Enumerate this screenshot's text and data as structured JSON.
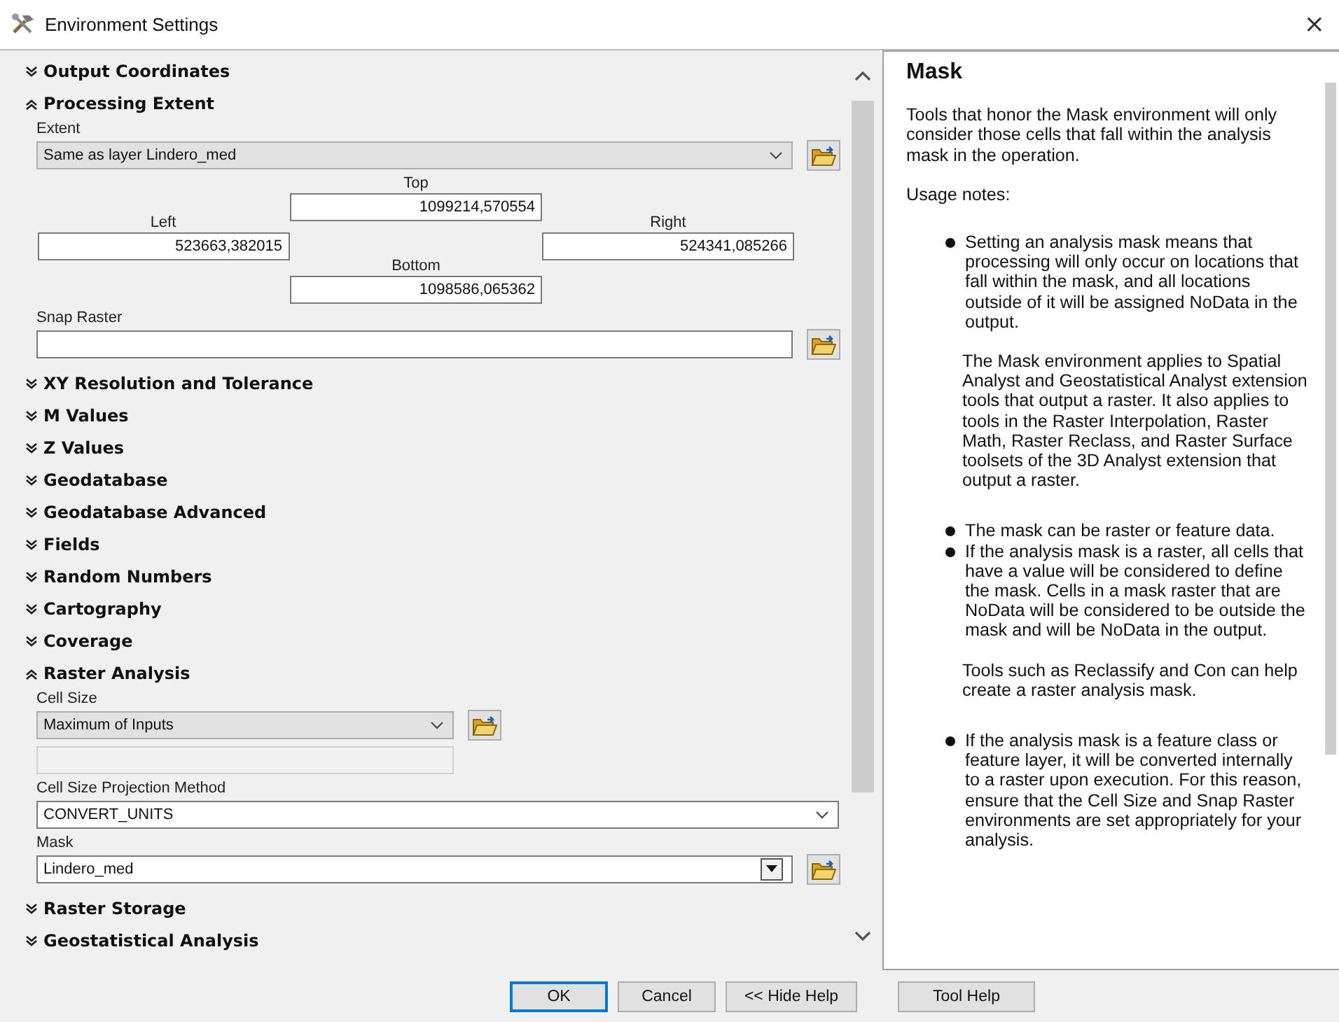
{
  "window": {
    "title": "Environment Settings",
    "close": "×"
  },
  "sections": [
    {
      "title": "Output Coordinates",
      "expanded": false
    },
    {
      "title": "Processing Extent",
      "expanded": true,
      "fields": [
        {
          "kind": "dropdown",
          "label": "Extent",
          "value": "Same as layer Lindero_med",
          "browse": true
        },
        {
          "kind": "extent",
          "top": {
            "label": "Top",
            "value": "1099214,570554"
          },
          "left": {
            "label": "Left",
            "value": "523663,382015"
          },
          "right": {
            "label": "Right",
            "value": "524341,085266"
          },
          "bottom": {
            "label": "Bottom",
            "value": "1098586,065362"
          }
        },
        {
          "kind": "path",
          "label": "Snap Raster",
          "browse": true
        }
      ]
    },
    {
      "title": "XY Resolution and Tolerance",
      "expanded": false
    },
    {
      "title": "M Values",
      "expanded": false
    },
    {
      "title": "Z Values",
      "expanded": false
    },
    {
      "title": "Geodatabase",
      "expanded": false
    },
    {
      "title": "Geodatabase Advanced",
      "expanded": false
    },
    {
      "title": "Fields",
      "expanded": false
    },
    {
      "title": "Random Numbers",
      "expanded": false
    },
    {
      "title": "Cartography",
      "expanded": false
    },
    {
      "title": "Coverage",
      "expanded": false
    },
    {
      "title": "Raster Analysis",
      "expanded": true,
      "fields": [
        {
          "kind": "short-dropdown",
          "label": "Cell Size",
          "value": "Maximum of Inputs",
          "browse": true
        },
        {
          "kind": "disabled-field"
        },
        {
          "kind": "dropdown",
          "label": "Cell Size Projection Method",
          "value": "CONVERT_UNITS",
          "browse": false
        },
        {
          "kind": "combo",
          "label": "Mask",
          "value": "Lindero_med",
          "browse": true
        }
      ]
    },
    {
      "title": "Raster Storage",
      "expanded": false
    },
    {
      "title": "Geostatistical Analysis",
      "expanded": false
    }
  ],
  "help": {
    "title": "Mask",
    "intro": "Tools that honor the Mask environment will only consider those cells that fall within the analysis mask in the operation.",
    "usage_heading": "Usage notes:",
    "items": [
      {
        "kind": "bullet",
        "text": "Setting an analysis mask means that processing will only occur on locations that fall within the mask, and all locations outside of it will be assigned NoData in the output."
      },
      {
        "kind": "para",
        "text": "The Mask environment applies to Spatial Analyst and Geostatistical Analyst extension tools that output a raster. It also applies to tools in the Raster Interpolation, Raster Math, Raster Reclass, and Raster Surface toolsets of the 3D Analyst extension that output a raster."
      },
      {
        "kind": "bullet",
        "text": "The mask can be raster or feature data."
      },
      {
        "kind": "bullet",
        "text": "If the analysis mask is a raster, all cells that have a value will be considered to define the mask. Cells in a mask raster that are NoData will be considered to be outside the mask and will be NoData in the output."
      },
      {
        "kind": "para",
        "text": "Tools such as Reclassify and Con can help create a raster analysis mask."
      },
      {
        "kind": "bullet",
        "text": "If the analysis mask is a feature class or feature layer, it will be converted internally to a raster upon execution. For this reason, ensure that the Cell Size and Snap Raster environments are set appropriately for your analysis."
      }
    ]
  },
  "buttons": [
    {
      "label": "OK",
      "default": true
    },
    {
      "label": "Cancel",
      "default": false
    },
    {
      "label": "<< Hide Help",
      "default": false
    },
    {
      "label": "Tool Help",
      "default": false
    }
  ]
}
